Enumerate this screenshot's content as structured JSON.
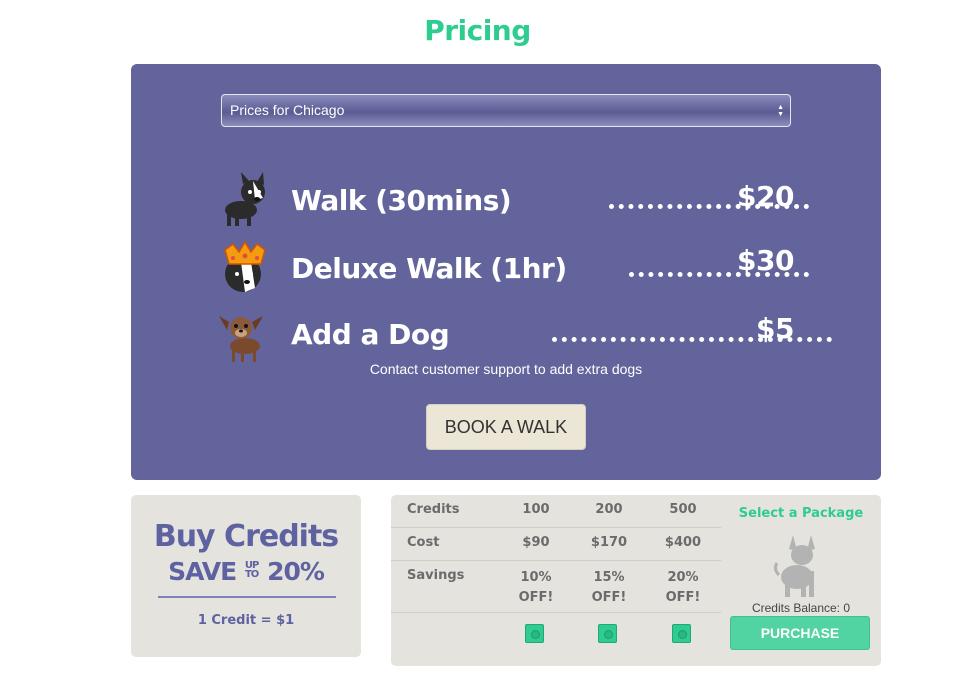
{
  "page": {
    "title": "Pricing"
  },
  "pricing": {
    "city_select": {
      "value": "Prices for Chicago",
      "arrow_up": "▲",
      "arrow_down": "▼"
    },
    "items": [
      {
        "label": "Walk (30mins)",
        "price": "$20",
        "icon": "boston-terrier-icon"
      },
      {
        "label": "Deluxe Walk (1hr)",
        "price": "$30",
        "icon": "crowned-dog-icon"
      },
      {
        "label": "Add a Dog",
        "price": "$5",
        "icon": "brown-dog-icon"
      }
    ],
    "note": "Contact customer support to add extra dogs",
    "book_button": "BOOK A WALK"
  },
  "credits_promo": {
    "headline": "Buy Credits",
    "save_word": "SAVE",
    "up": "UP",
    "to": "TO",
    "percent": "20%",
    "rate": "1 Credit = $1"
  },
  "packages": {
    "rows": [
      {
        "label": "Credits",
        "values": [
          "100",
          "200",
          "500"
        ]
      },
      {
        "label": "Cost",
        "values": [
          "$90",
          "$170",
          "$400"
        ]
      },
      {
        "label": "Savings",
        "values": [
          "10%",
          "15%",
          "20%"
        ],
        "suffix": "OFF!"
      }
    ],
    "select_heading": "Select a Package",
    "silhouette_icon": "dog-silhouette-icon",
    "balance": "Credits Balance: 0",
    "purchase_button": "PURCHASE",
    "colors": {
      "accent": "#2ecc8f",
      "panel": "#62649b",
      "card": "#e4e3de"
    }
  }
}
